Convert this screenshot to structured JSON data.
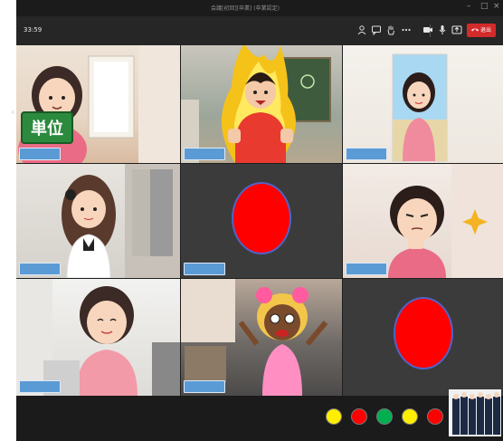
{
  "window": {
    "title": "会議[初回][卒業] (卒業認定)",
    "min_icon": "–",
    "max_icon": "□",
    "close_icon": "×"
  },
  "toolbar": {
    "timer": "33:59",
    "hangup_label": "退出",
    "icons": {
      "participants": "participants-icon",
      "chat": "chat-icon",
      "raise_hand": "raise-hand-icon",
      "more": "more-icon",
      "camera": "camera-icon",
      "mic": "mic-icon",
      "share": "share-icon",
      "hangup": "phone-hangup-icon"
    }
  },
  "tiles": [
    {
      "id": "tile-1",
      "sign_text": "単位"
    },
    {
      "id": "tile-2"
    },
    {
      "id": "tile-3"
    },
    {
      "id": "tile-4"
    },
    {
      "id": "tile-5",
      "camera": "off"
    },
    {
      "id": "tile-6"
    },
    {
      "id": "tile-7"
    },
    {
      "id": "tile-8"
    },
    {
      "id": "tile-9",
      "camera": "off"
    }
  ],
  "reactions": [
    {
      "color": "#ffee00"
    },
    {
      "color": "#ff0000"
    },
    {
      "color": "#00b050"
    },
    {
      "color": "#ffee00"
    },
    {
      "color": "#ff0000"
    }
  ],
  "colors": {
    "name_tag": "#5b9bd5",
    "camera_off_circle": "#ff0000",
    "hangup_button": "#d32a2a",
    "app_background": "#1f1f1f"
  }
}
